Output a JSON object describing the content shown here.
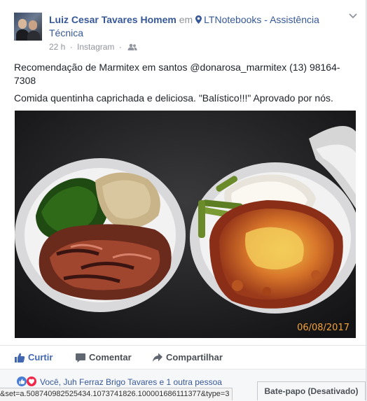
{
  "post": {
    "author": "Luiz Cesar Tavares Homem",
    "connector": "em",
    "place": "LTNotebooks - Assistência Técnica",
    "time": "22 h",
    "source": "Instagram",
    "meta_sep": "·",
    "text_line1": "Recomendação de Marmitex em santos @donarosa_marmitex (13) 98164-7308",
    "text_line2": "Comida quentinha caprichada e deliciosa. \"Balístico!!!\" Aprovado por nós.",
    "photo_date": "06/08/2017"
  },
  "actions": {
    "like": "Curtir",
    "comment": "Comentar",
    "share": "Compartilhar"
  },
  "reactions": {
    "text": "Você, Juh Ferraz Brigo Tavares e 1 outra pessoa"
  },
  "status_url": "&set=a.508740982525434.1073741826.100001686111377&type=3",
  "chat_label": "Bate-papo (Desativado)",
  "colors": {
    "link": "#365899",
    "like_active": "#4267b2",
    "date_stamp": "#f3a23a"
  }
}
